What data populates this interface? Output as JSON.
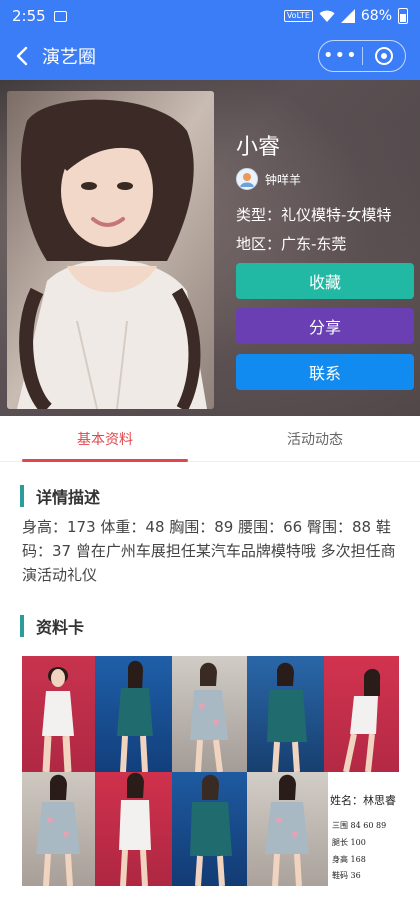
{
  "status_bar": {
    "time": "2:55",
    "volte": "VoLTE",
    "battery": "68%"
  },
  "nav": {
    "title": "演艺圈",
    "capsule_menu": "•••"
  },
  "profile": {
    "name": "小睿",
    "author": "钟咩羊",
    "type": "类型：礼仪模特-女模特",
    "region": "地区：广东-东莞"
  },
  "actions": {
    "favorite": "收藏",
    "share": "分享",
    "contact": "联系"
  },
  "tabs": [
    {
      "label": "基本资料",
      "active": true
    },
    {
      "label": "活动动态",
      "active": false
    }
  ],
  "details": {
    "title": "详情描述",
    "text": "身高：173 体重：48 胸围：89 腰围：66 臀围：88 鞋码：37 曾在广州车展担任某汽车品牌模特哦 多次担任商演活动礼仪"
  },
  "card": {
    "title": "资料卡",
    "name_line": "姓名：林思睿",
    "lines": [
      "三围 84 60 89",
      "腿长 100",
      "身高 168",
      "鞋码 36"
    ]
  },
  "colors": {
    "nav_bg": "#3b7df6",
    "favorite": "#22b9a4",
    "share": "#6a3fb3",
    "contact": "#118bf0",
    "active_tab": "#e0474c",
    "section_bar": "#2a9d9a"
  }
}
